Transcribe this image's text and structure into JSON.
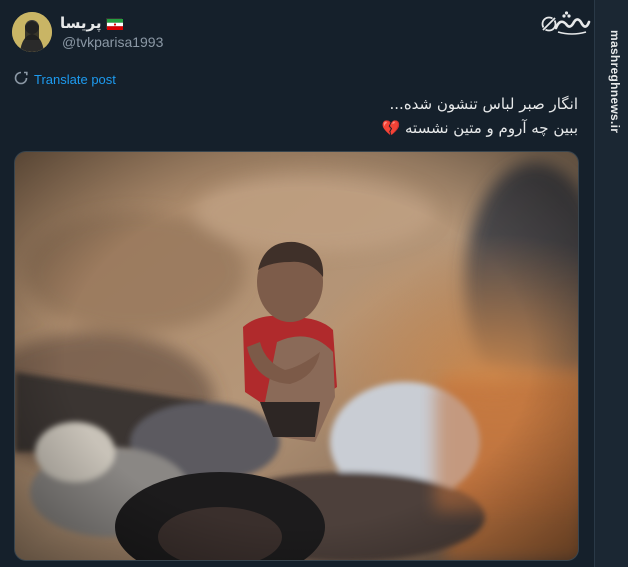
{
  "author": {
    "display_name": "پریسا",
    "handle": "@tvkparisa1993",
    "flag_icon": "iran-flag-icon"
  },
  "actions": {
    "translate_label": "Translate post"
  },
  "post": {
    "line1": "انگار صبر لباس تنشون شده...",
    "line2": "ببین چه آروم و متین نشسته",
    "emoji": "💔"
  },
  "watermark": {
    "site": "mashreghnews.ir"
  },
  "colors": {
    "background": "#15202b",
    "accent": "#1d9bf0",
    "secondary_text": "#8b98a5",
    "primary_text": "#e7e9ea"
  }
}
